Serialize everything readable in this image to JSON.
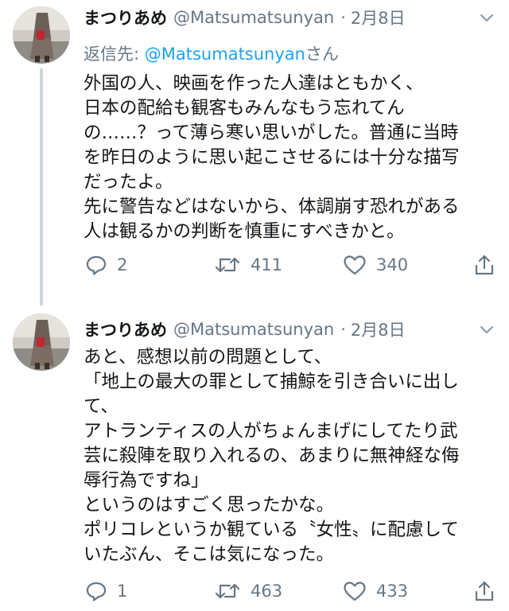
{
  "tweets": [
    {
      "name": "まつりあめ",
      "handle": "@Matsumatsunyan",
      "dot": "·",
      "date": "2月8日",
      "reply_prefix": "返信先: ",
      "reply_mention": "@Matsumatsunyan",
      "reply_suffix": "さん",
      "lines": [
        "外国の人、映画を作った人達はともかく、",
        "日本の配給も観客もみんなもう忘れてん",
        "の……？って薄ら寒い思いがした。普通に当時",
        "を昨日のように思い起こさせるには十分な描写",
        "だったよ。",
        "先に警告などはないから、体調崩す恐れがある",
        "人は観るかの判断を慎重にすべきかと。"
      ],
      "reply_count": "2",
      "retweet_count": "411",
      "like_count": "340"
    },
    {
      "name": "まつりあめ",
      "handle": "@Matsumatsunyan",
      "dot": "·",
      "date": "2月8日",
      "lines": [
        "あと、感想以前の問題として、",
        "「地上の最大の罪として捕鯨を引き合いに出し",
        "て、",
        "アトランティスの人がちょんまげにしてたり武",
        "芸に殺陣を取り入れるの、あまりに無神経な侮",
        "辱行為ですね」",
        "というのはすごく思ったかな。",
        "ポリコレというか観ている〝女性〟に配慮して",
        "いたぶん、そこは気になった。"
      ],
      "reply_count": "1",
      "retweet_count": "463",
      "like_count": "433"
    }
  ],
  "icons": {
    "reply": "reply-icon",
    "retweet": "retweet-icon",
    "like": "heart-icon",
    "share": "share-icon",
    "more": "chevron-down-icon"
  },
  "colors": {
    "text": "#14171a",
    "secondary": "#657786",
    "mention": "#1da1f2",
    "thread_line": "#ccd6dd"
  }
}
